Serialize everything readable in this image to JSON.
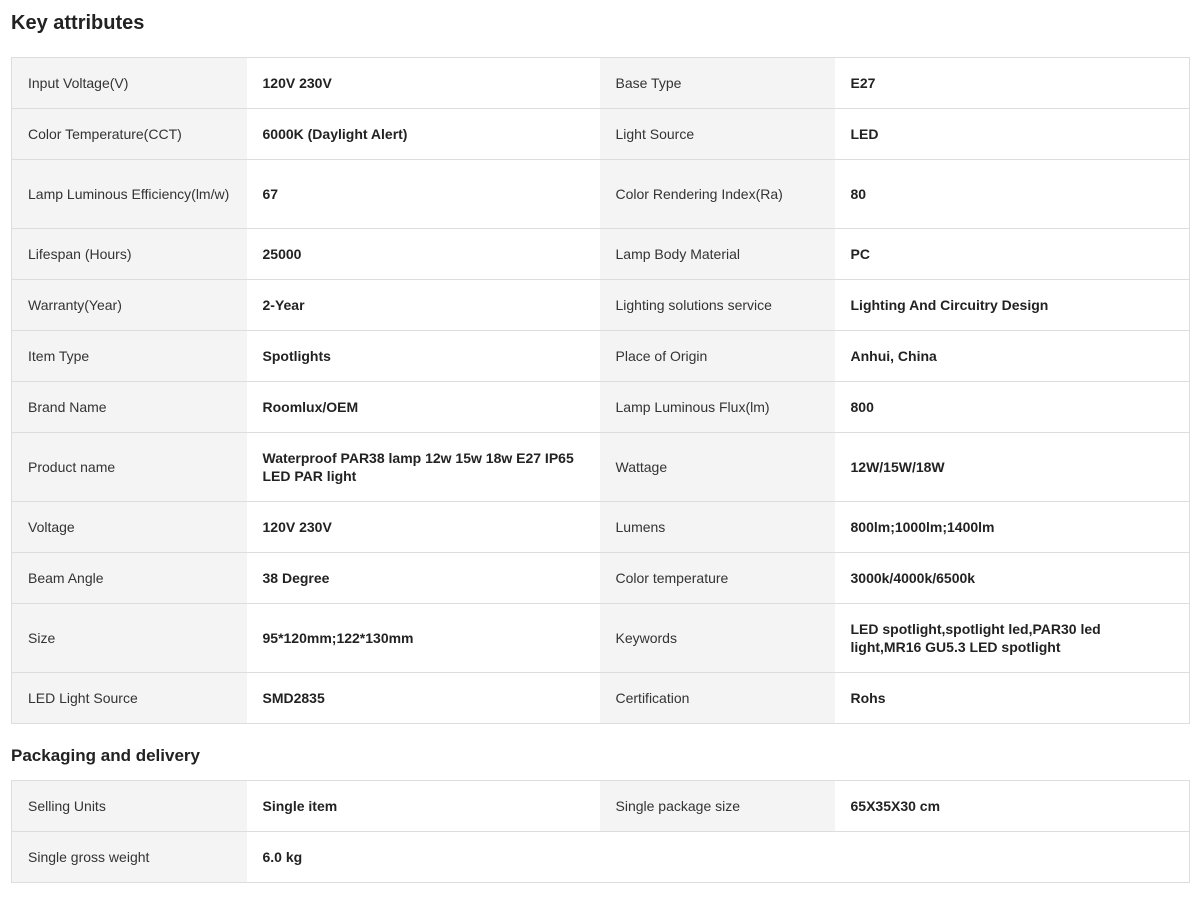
{
  "key_attributes": {
    "title": "Key attributes",
    "rows": [
      {
        "label1": "Input Voltage(V)",
        "value1": "120V 230V",
        "label2": "Base Type",
        "value2": "E27"
      },
      {
        "label1": "Color Temperature(CCT)",
        "value1": "6000K (Daylight Alert)",
        "label2": "Light Source",
        "value2": "LED"
      },
      {
        "label1": "Lamp Luminous Efficiency(lm/w)",
        "value1": "67",
        "label2": "Color Rendering Index(Ra)",
        "value2": "80"
      },
      {
        "label1": "Lifespan (Hours)",
        "value1": "25000",
        "label2": "Lamp Body Material",
        "value2": "PC"
      },
      {
        "label1": "Warranty(Year)",
        "value1": "2-Year",
        "label2": "Lighting solutions service",
        "value2": "Lighting And Circuitry Design"
      },
      {
        "label1": "Item Type",
        "value1": "Spotlights",
        "label2": "Place of Origin",
        "value2": "Anhui, China"
      },
      {
        "label1": "Brand Name",
        "value1": "Roomlux/OEM",
        "label2": "Lamp Luminous Flux(lm)",
        "value2": "800"
      },
      {
        "label1": "Product name",
        "value1": "Waterproof PAR38 lamp 12w 15w 18w E27 IP65 LED PAR light",
        "label2": "Wattage",
        "value2": "12W/15W/18W"
      },
      {
        "label1": "Voltage",
        "value1": "120V 230V",
        "label2": "Lumens",
        "value2": "800lm;1000lm;1400lm"
      },
      {
        "label1": "Beam Angle",
        "value1": "38 Degree",
        "label2": "Color temperature",
        "value2": "3000k/4000k/6500k"
      },
      {
        "label1": "Size",
        "value1": "95*120mm;122*130mm",
        "label2": "Keywords",
        "value2": "LED spotlight,spotlight led,PAR30 led light,MR16 GU5.3 LED spotlight"
      },
      {
        "label1": "LED Light Source",
        "value1": "SMD2835",
        "label2": "Certification",
        "value2": "Rohs"
      }
    ]
  },
  "packaging": {
    "title": "Packaging and delivery",
    "rows": [
      {
        "label1": "Selling Units",
        "value1": "Single item",
        "label2": "Single package size",
        "value2": "65X35X30 cm"
      },
      {
        "label1": "Single gross weight",
        "value1": "6.0 kg"
      }
    ]
  }
}
